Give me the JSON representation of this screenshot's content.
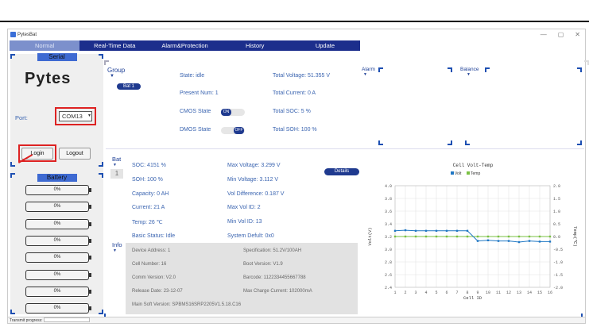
{
  "window": {
    "title": "PytesBat",
    "min": "—",
    "max": "▢",
    "close": "✕"
  },
  "tabs": [
    "Normal",
    "Real-Time Data",
    "Alarm&Protection",
    "History",
    "Update"
  ],
  "serial": {
    "title": "Serial",
    "logo": "Pytes",
    "port_label": "Port:",
    "port_value": "COM13",
    "login": "Login",
    "logout": "Logout"
  },
  "battery": {
    "title": "Battery",
    "cells": [
      "0%",
      "0%",
      "0%",
      "0%",
      "0%",
      "0%",
      "0%",
      "0%"
    ]
  },
  "group": {
    "title": "Group",
    "bat_button": "Bat 1",
    "state": "State: idle",
    "present": "Present Num: 1",
    "cmos_label": "CMOS State",
    "cmos_toggle": "ON",
    "dmos_label": "DMOS State",
    "dmos_toggle": "OFF",
    "total_voltage": "Total Voltage: 51.355 V",
    "total_current": "Total Current: 0 A",
    "total_soc": "Total SOC: 5 %",
    "total_soh": "Total SOH: 100 %"
  },
  "alarm": {
    "title": "Alarm"
  },
  "balance": {
    "title": "Balance"
  },
  "bat": {
    "title": "Bat",
    "index": "1",
    "soc": "SOC: 4151 %",
    "soh": "SOH: 100 %",
    "capacity": "Capacity: 0 AH",
    "current": "Current: 21 A",
    "temp": "Temp: 26 ℃",
    "basic": "Basic Status: Idle",
    "max_v": "Max Voltage: 3.299 V",
    "min_v": "Min Voltage: 3.112 V",
    "vol_diff": "Vol Difference: 0.187 V",
    "max_id": "Max Vol ID: 2",
    "min_id": "Min Vol ID: 13",
    "sys": "System Defult: 0x0",
    "details": "Details"
  },
  "info": {
    "title": "Info",
    "device": "Device Address: 1",
    "cellnum": "Cell Number: 16",
    "comm": "Comm Version: V2.0",
    "release": "Release Date: 23-12-07",
    "main": "Main Soft Version: SPBMS16SRP2205V1.5.18.C16",
    "spec": "Specification: 51.2V/100AH",
    "boot": "Boot Version: V1.9",
    "barcode": "Barcode: 1122334455667788",
    "maxcharge": "Max Charge Current: 102000mA"
  },
  "status": {
    "label": "Transmit progress:"
  },
  "chart_data": {
    "type": "line",
    "title": "Cell Volt-Temp",
    "xlabel": "Cell ID",
    "ylabel": "Volt(V)",
    "y2label": "Temp(℃)",
    "x": [
      1,
      2,
      3,
      4,
      5,
      6,
      7,
      8,
      9,
      10,
      11,
      12,
      13,
      14,
      15,
      16
    ],
    "xlim": [
      1,
      16
    ],
    "ylim": [
      2.4,
      4.0
    ],
    "y2lim": [
      -2.0,
      2.0
    ],
    "yticks": [
      "4.0",
      "3.8",
      "3.6",
      "3.4",
      "3.2",
      "3.0",
      "2.8",
      "2.6",
      "2.4"
    ],
    "y2ticks": [
      "2.0",
      "1.5",
      "1.0",
      "0.5",
      "0.0",
      "-0.5",
      "-1.0",
      "-1.5",
      "-2.0"
    ],
    "series": [
      {
        "name": "Volt",
        "color": "#1f77c4",
        "values": [
          3.29,
          3.299,
          3.29,
          3.29,
          3.29,
          3.29,
          3.29,
          3.29,
          3.13,
          3.14,
          3.13,
          3.13,
          3.112,
          3.13,
          3.12,
          3.12
        ]
      },
      {
        "name": "Temp",
        "color": "#7ac143",
        "values": [
          0.0,
          0.0,
          0.0,
          0.0,
          0.0,
          0.0,
          0.0,
          0.0,
          0.0,
          0.0,
          0.0,
          0.0,
          0.0,
          0.0,
          0.0,
          0.0
        ],
        "axis": "right"
      }
    ]
  }
}
